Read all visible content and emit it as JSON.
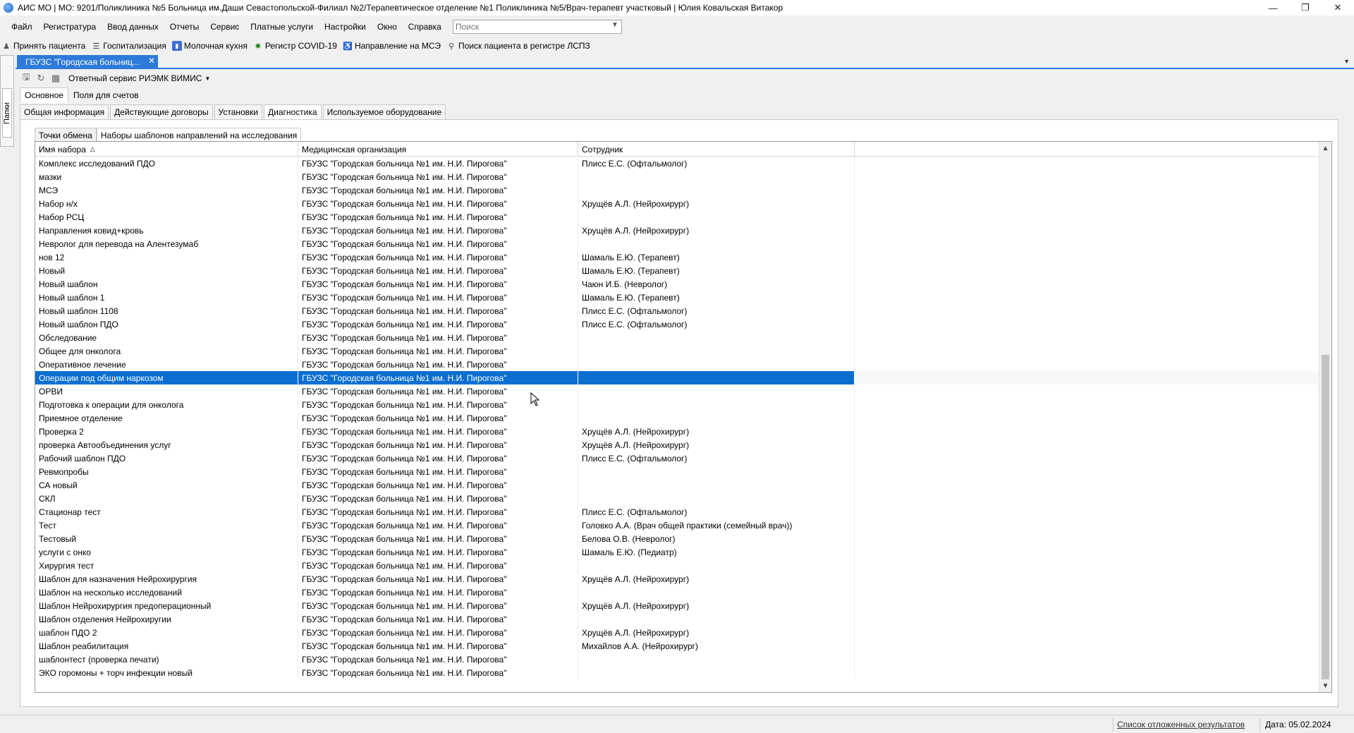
{
  "window": {
    "title": "АИС МО | МО: 9201/Поликлиника №5 Больница им.Даши Севастопольской-Филиал №2/Терапевтическое отделение №1 Поликлиника №5/Врач-терапевт участковый | Юлия Ковальская Витакор",
    "minimize": "—",
    "maximize": "❐",
    "close": "✕"
  },
  "menu": {
    "items": [
      "Файл",
      "Регистратура",
      "Ввод данных",
      "Отчеты",
      "Сервис",
      "Платные услуги",
      "Настройки",
      "Окно",
      "Справка"
    ],
    "search_placeholder": "Поиск"
  },
  "quickbar": {
    "items": [
      {
        "label": "Принять пациента",
        "icon": "person-icon"
      },
      {
        "label": "Госпитализация",
        "icon": "hospital-bed-icon"
      },
      {
        "label": "Молочная кухня",
        "icon": "milk-bottle-icon"
      },
      {
        "label": "Регистр COVID-19",
        "icon": "virus-icon"
      },
      {
        "label": "Направление на МСЭ",
        "icon": "wheelchair-icon"
      },
      {
        "label": "Поиск пациента в регистре ЛСПЗ",
        "icon": "find-patient-icon"
      }
    ]
  },
  "left_panel": {
    "folders_label": "Папки"
  },
  "document_tab": {
    "label": "ГБУЗС \"Городская больниц...",
    "close": "✕"
  },
  "toolbar": {
    "service_label": "Ответный сервис РИЭМК ВИМИС"
  },
  "tabs_level1": [
    "Основное",
    "Поля для счетов"
  ],
  "tabs_level2": [
    "Общая информация",
    "Действующие договоры",
    "Установки",
    "Диагностика",
    "Используемое оборудование"
  ],
  "tabs_level3": [
    "Точки обмена",
    "Наборы шаблонов направлений на исследования"
  ],
  "grid": {
    "columns": [
      "Имя набора",
      "Медицинская организация",
      "Сотрудник"
    ],
    "selected_index": 16,
    "rows": [
      {
        "name": "Комплекс исследований ПДО",
        "org": "ГБУЗС \"Городская больница №1 им. Н.И. Пирогова\"",
        "emp": "Плисс Е.С. (Офтальмолог)"
      },
      {
        "name": "мазки",
        "org": "ГБУЗС \"Городская больница №1 им. Н.И. Пирогова\"",
        "emp": ""
      },
      {
        "name": "МСЭ",
        "org": "ГБУЗС \"Городская больница №1 им. Н.И. Пирогова\"",
        "emp": ""
      },
      {
        "name": "Набор н/х",
        "org": "ГБУЗС \"Городская больница №1 им. Н.И. Пирогова\"",
        "emp": "Хрущёв А.Л. (Нейрохирург)"
      },
      {
        "name": "Набор РСЦ",
        "org": "ГБУЗС \"Городская больница №1 им. Н.И. Пирогова\"",
        "emp": ""
      },
      {
        "name": "Направления ковид+кровь",
        "org": "ГБУЗС \"Городская больница №1 им. Н.И. Пирогова\"",
        "emp": "Хрущёв А.Л. (Нейрохирург)"
      },
      {
        "name": "Невролог для перевода на Алентезумаб",
        "org": "ГБУЗС \"Городская больница №1 им. Н.И. Пирогова\"",
        "emp": ""
      },
      {
        "name": "нов 12",
        "org": "ГБУЗС \"Городская больница №1 им. Н.И. Пирогова\"",
        "emp": "Шамаль Е.Ю. (Терапевт)"
      },
      {
        "name": "Новый",
        "org": "ГБУЗС \"Городская больница №1 им. Н.И. Пирогова\"",
        "emp": "Шамаль Е.Ю. (Терапевт)"
      },
      {
        "name": "Новый шаблон",
        "org": "ГБУЗС \"Городская больница №1 им. Н.И. Пирогова\"",
        "emp": "Чаюн И.Б. (Невролог)"
      },
      {
        "name": "Новый шаблон 1",
        "org": "ГБУЗС \"Городская больница №1 им. Н.И. Пирогова\"",
        "emp": "Шамаль Е.Ю. (Терапевт)"
      },
      {
        "name": "Новый шаблон 1108",
        "org": "ГБУЗС \"Городская больница №1 им. Н.И. Пирогова\"",
        "emp": "Плисс Е.С. (Офтальмолог)"
      },
      {
        "name": "Новый шаблон ПДО",
        "org": "ГБУЗС \"Городская больница №1 им. Н.И. Пирогова\"",
        "emp": "Плисс Е.С. (Офтальмолог)"
      },
      {
        "name": "Обследование",
        "org": "ГБУЗС \"Городская больница №1 им. Н.И. Пирогова\"",
        "emp": ""
      },
      {
        "name": "Общее для онколога",
        "org": "ГБУЗС \"Городская больница №1 им. Н.И. Пирогова\"",
        "emp": ""
      },
      {
        "name": "Оперативное лечение",
        "org": "ГБУЗС \"Городская больница №1 им. Н.И. Пирогова\"",
        "emp": ""
      },
      {
        "name": "Операции под общим наркозом",
        "org": "ГБУЗС \"Городская больница №1 им. Н.И. Пирогова\"",
        "emp": ""
      },
      {
        "name": "ОРВИ",
        "org": "ГБУЗС \"Городская больница №1 им. Н.И. Пирогова\"",
        "emp": ""
      },
      {
        "name": "Подготовка к операции для онколога",
        "org": "ГБУЗС \"Городская больница №1 им. Н.И. Пирогова\"",
        "emp": ""
      },
      {
        "name": "Приемное отделение",
        "org": "ГБУЗС \"Городская больница №1 им. Н.И. Пирогова\"",
        "emp": ""
      },
      {
        "name": "Проверка 2",
        "org": "ГБУЗС \"Городская больница №1 им. Н.И. Пирогова\"",
        "emp": "Хрущёв А.Л. (Нейрохирург)"
      },
      {
        "name": "проверка Автообъединения услуг",
        "org": "ГБУЗС \"Городская больница №1 им. Н.И. Пирогова\"",
        "emp": "Хрущёв А.Л. (Нейрохирург)"
      },
      {
        "name": "Рабочий шаблон ПДО",
        "org": "ГБУЗС \"Городская больница №1 им. Н.И. Пирогова\"",
        "emp": "Плисс Е.С. (Офтальмолог)"
      },
      {
        "name": "Ревмопробы",
        "org": "ГБУЗС \"Городская больница №1 им. Н.И. Пирогова\"",
        "emp": ""
      },
      {
        "name": "СА новый",
        "org": "ГБУЗС \"Городская больница №1 им. Н.И. Пирогова\"",
        "emp": ""
      },
      {
        "name": "СКЛ",
        "org": "ГБУЗС \"Городская больница №1 им. Н.И. Пирогова\"",
        "emp": ""
      },
      {
        "name": "Стационар тест",
        "org": "ГБУЗС \"Городская больница №1 им. Н.И. Пирогова\"",
        "emp": "Плисс Е.С. (Офтальмолог)"
      },
      {
        "name": "Тест",
        "org": "ГБУЗС \"Городская больница №1 им. Н.И. Пирогова\"",
        "emp": "Головко А.А. (Врач общей практики (семейный врач))"
      },
      {
        "name": "Тестовый",
        "org": "ГБУЗС \"Городская больница №1 им. Н.И. Пирогова\"",
        "emp": "Белова О.В. (Невролог)"
      },
      {
        "name": "услуги с онко",
        "org": "ГБУЗС \"Городская больница №1 им. Н.И. Пирогова\"",
        "emp": "Шамаль Е.Ю. (Педиатр)"
      },
      {
        "name": "Хирургия тест",
        "org": "ГБУЗС \"Городская больница №1 им. Н.И. Пирогова\"",
        "emp": ""
      },
      {
        "name": "Шаблон для назначения Нейрохирургия",
        "org": "ГБУЗС \"Городская больница №1 им. Н.И. Пирогова\"",
        "emp": "Хрущёв А.Л. (Нейрохирург)"
      },
      {
        "name": "Шаблон на несколько исследований",
        "org": "ГБУЗС \"Городская больница №1 им. Н.И. Пирогова\"",
        "emp": ""
      },
      {
        "name": "Шаблон Нейрохирургия предоперационный",
        "org": "ГБУЗС \"Городская больница №1 им. Н.И. Пирогова\"",
        "emp": "Хрущёв А.Л. (Нейрохирург)"
      },
      {
        "name": "Шаблон отделения Нейрохиругии",
        "org": "ГБУЗС \"Городская больница №1 им. Н.И. Пирогова\"",
        "emp": ""
      },
      {
        "name": "шаблон ПДО 2",
        "org": "ГБУЗС \"Городская больница №1 им. Н.И. Пирогова\"",
        "emp": "Хрущёв А.Л. (Нейрохирург)"
      },
      {
        "name": "Шаблон реабилитация",
        "org": "ГБУЗС \"Городская больница №1 им. Н.И. Пирогова\"",
        "emp": "Михайлов А.А. (Нейрохирург)"
      },
      {
        "name": "шаблонтест (проверка печати)",
        "org": "ГБУЗС \"Городская больница №1 им. Н.И. Пирогова\"",
        "emp": ""
      },
      {
        "name": "ЭКО горомоны + торч инфекции новый",
        "org": "ГБУЗС \"Городская больница №1 им. Н.И. Пирогова\"",
        "emp": ""
      }
    ]
  },
  "status": {
    "deferred_link": "Список отложенных результатов",
    "date": "Дата: 05.02.2024"
  },
  "colors": {
    "accent": "#2e7ad8",
    "selection": "#0b6fd1",
    "highlight_red": "#e01010"
  }
}
